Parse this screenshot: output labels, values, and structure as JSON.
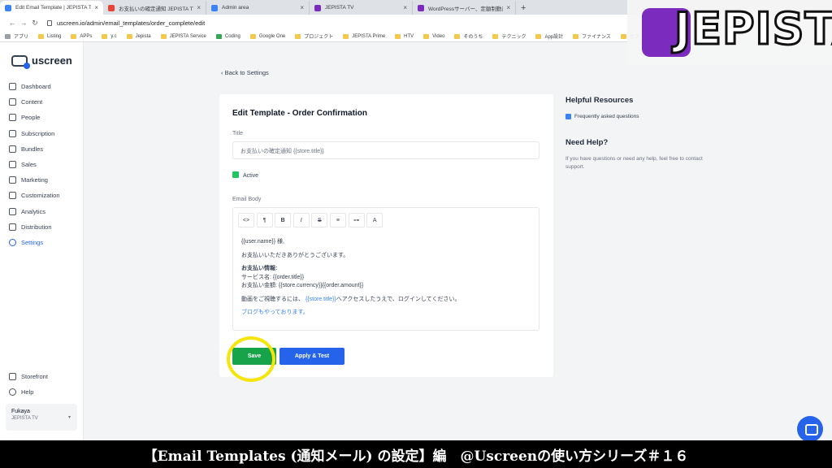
{
  "browser": {
    "tabs": [
      {
        "title": "Edit Email Template | JEPISTA TV",
        "color": "#3b82f6"
      },
      {
        "title": "お支払いの確定通知 JEPISTA TV -",
        "color": "#ea4335"
      },
      {
        "title": "Admin area",
        "color": "#3b82f6"
      },
      {
        "title": "JEPISTA TV",
        "color": "#7b2cbf"
      },
      {
        "title": "WordPressサーバー、定額制動画配",
        "color": "#7b2cbf"
      }
    ],
    "url": "uscreen.io/admin/email_templates/order_complete/edit",
    "bookmarks": [
      "アプリ",
      "Listing",
      "APPs",
      "y.c",
      "Jepista",
      "JEPISTA Service",
      "Coding",
      "Google One",
      "プロジェクト",
      "JEPISTA Prime",
      "HTV",
      "Video",
      "そのうち",
      "テクニック",
      "App設計",
      "ファイナンス",
      "セブ"
    ]
  },
  "logo_text": "JEPISTA",
  "brand": "uscreen",
  "sidebar": {
    "items": [
      "Dashboard",
      "Content",
      "People",
      "Subscription",
      "Bundles",
      "Sales",
      "Marketing",
      "Customization",
      "Analytics",
      "Distribution",
      "Settings"
    ],
    "bottom": [
      "Storefront",
      "Help"
    ],
    "user_name": "Fukaya",
    "user_site": "JEPISTA TV"
  },
  "main": {
    "back_link": "Back to Settings",
    "card_title": "Edit Template - Order Confirmation",
    "title_label": "Title",
    "title_value": "お支払いの確定通知 {{store.title}}",
    "active_label": "Active",
    "body_label": "Email Body",
    "toolbar": [
      "<>",
      "¶",
      "B",
      "I",
      "S",
      "≡",
      "⊶",
      "A"
    ],
    "body": {
      "l1": "{{user.name}} 様,",
      "l2": "お支払いいただきありがとうございます。",
      "l3": "お支払い情報:",
      "l4": "サービス名: {{order.title}}",
      "l5": "お支払い金額: {{store.currency}}{{order.amount}}",
      "l6a": "動画をご視聴するには、",
      "l6b": "{{store.title}}",
      "l6c": "へアクセスしたうえで、ログインしてください。",
      "l7": "ブログもやっております。"
    },
    "save_label": "Save",
    "apply_label": "Apply & Test"
  },
  "resources": {
    "title": "Helpful Resources",
    "link": "Frequently asked questions",
    "help_title": "Need Help?",
    "help_text": "If you have questions or need any help, feel free to contact support."
  },
  "caption": "【Email Templates (通知メール) の設定】編　@Uscreenの使い方シリーズ＃１６"
}
